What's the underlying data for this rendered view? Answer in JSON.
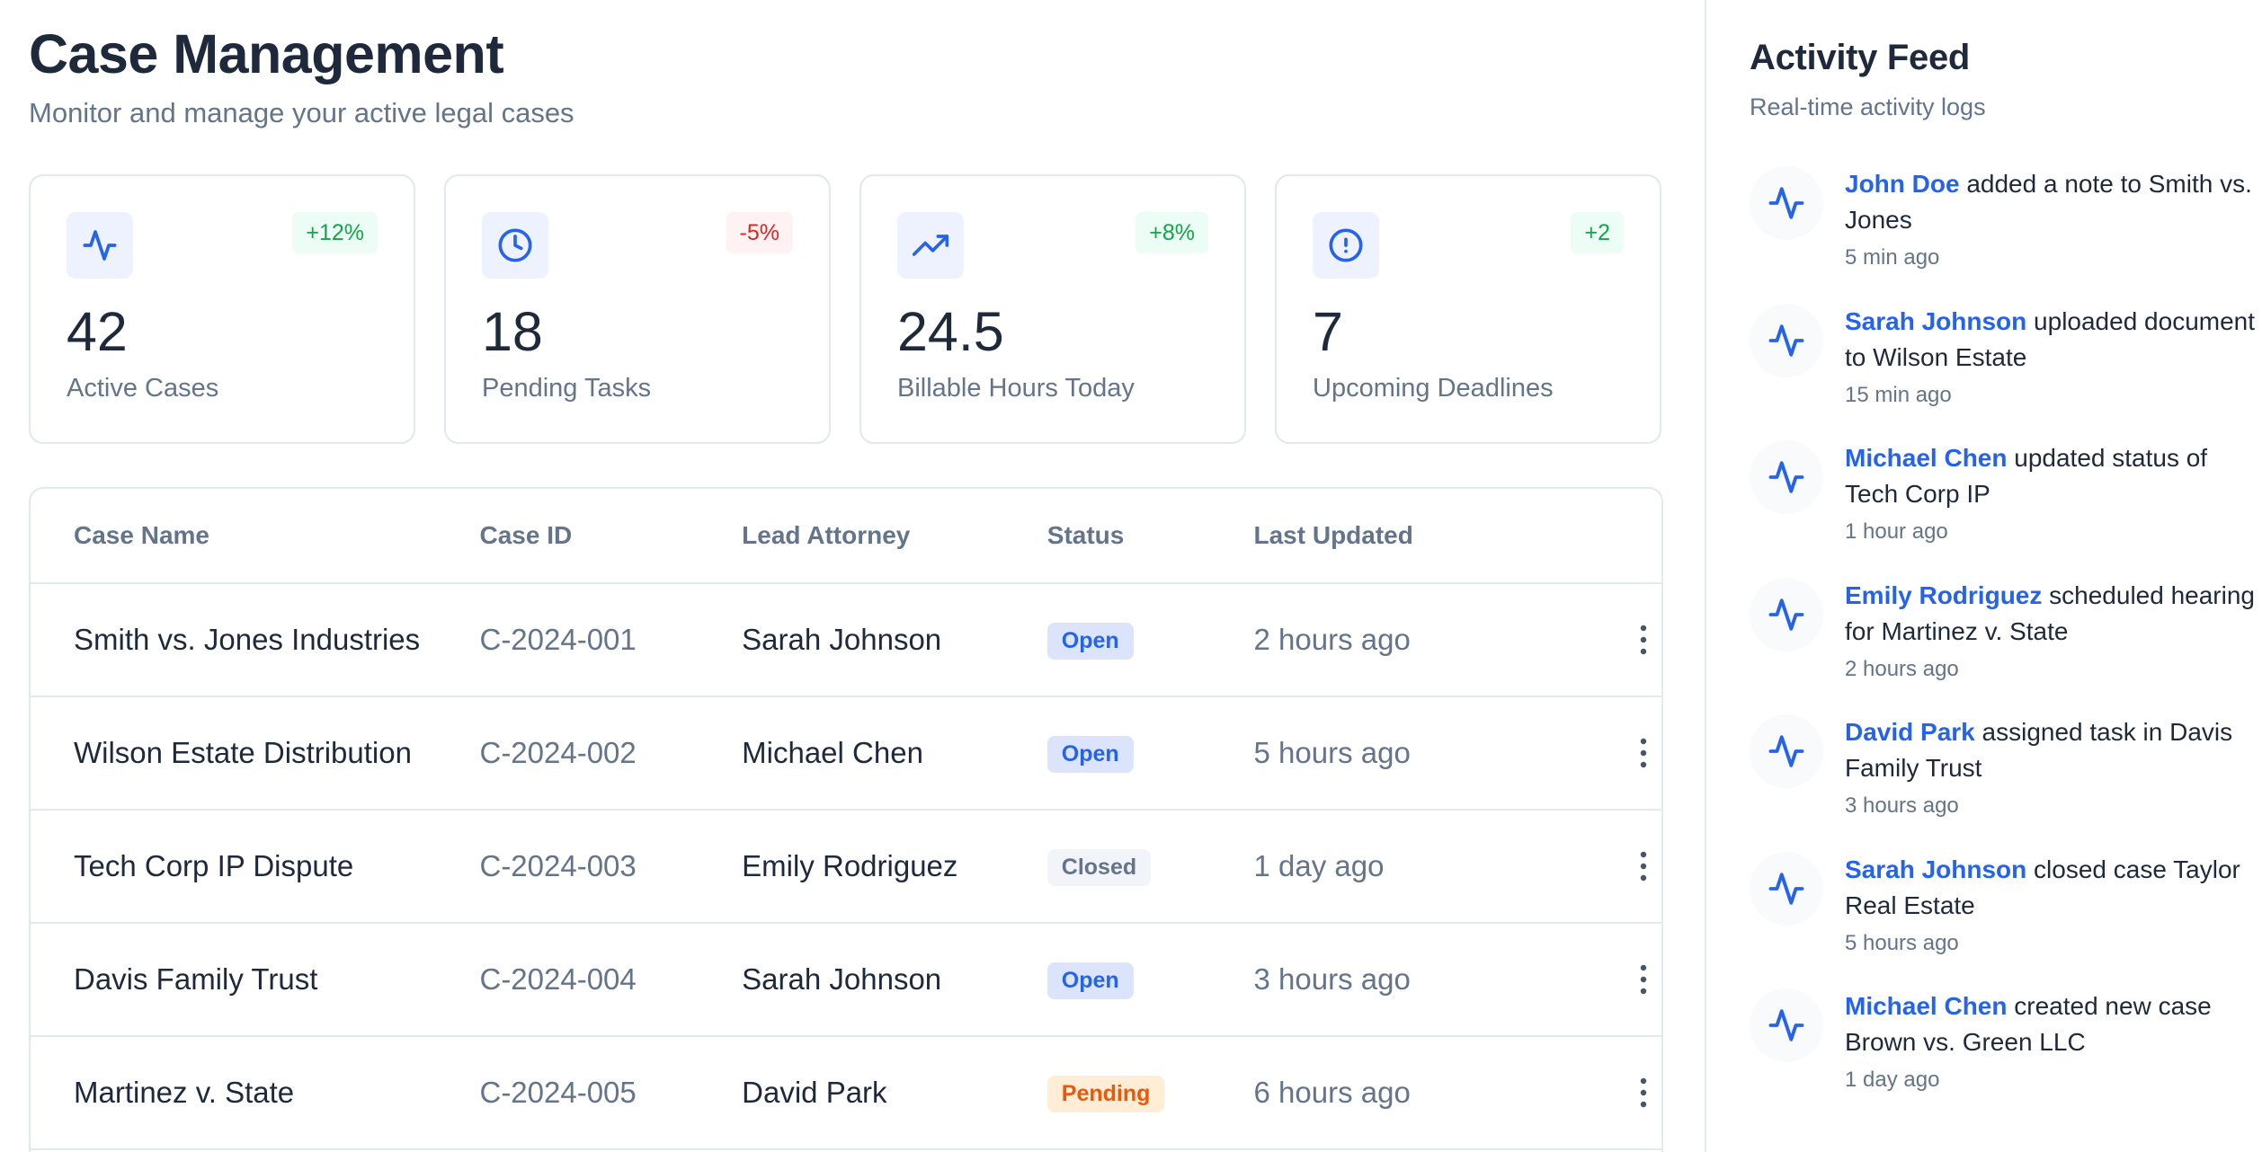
{
  "header": {
    "title": "Case Management",
    "subtitle": "Monitor and manage your active legal cases"
  },
  "stats": [
    {
      "icon": "activity-icon",
      "value": "42",
      "label": "Active Cases",
      "change": "+12%",
      "trend": "up"
    },
    {
      "icon": "clock-icon",
      "value": "18",
      "label": "Pending Tasks",
      "change": "-5%",
      "trend": "down"
    },
    {
      "icon": "trending-up-icon",
      "value": "24.5",
      "label": "Billable Hours Today",
      "change": "+8%",
      "trend": "up"
    },
    {
      "icon": "alert-circle-icon",
      "value": "7",
      "label": "Upcoming Deadlines",
      "change": "+2",
      "trend": "up"
    }
  ],
  "table": {
    "columns": [
      "Case Name",
      "Case ID",
      "Lead Attorney",
      "Status",
      "Last Updated"
    ],
    "rows": [
      {
        "name": "Smith vs. Jones Industries",
        "id": "C-2024-001",
        "attorney": "Sarah Johnson",
        "status": "Open",
        "updated": "2 hours ago"
      },
      {
        "name": "Wilson Estate Distribution",
        "id": "C-2024-002",
        "attorney": "Michael Chen",
        "status": "Open",
        "updated": "5 hours ago"
      },
      {
        "name": "Tech Corp IP Dispute",
        "id": "C-2024-003",
        "attorney": "Emily Rodriguez",
        "status": "Closed",
        "updated": "1 day ago"
      },
      {
        "name": "Davis Family Trust",
        "id": "C-2024-004",
        "attorney": "Sarah Johnson",
        "status": "Open",
        "updated": "3 hours ago"
      },
      {
        "name": "Martinez v. State",
        "id": "C-2024-005",
        "attorney": "David Park",
        "status": "Pending",
        "updated": "6 hours ago"
      }
    ]
  },
  "activity": {
    "title": "Activity Feed",
    "subtitle": "Real-time activity logs",
    "items": [
      {
        "user": "John Doe",
        "action": " added a note to Smith vs. Jones",
        "time": "5 min ago"
      },
      {
        "user": "Sarah Johnson",
        "action": " uploaded document to Wilson Estate",
        "time": "15 min ago"
      },
      {
        "user": "Michael Chen",
        "action": " updated status of Tech Corp IP",
        "time": "1 hour ago"
      },
      {
        "user": "Emily Rodriguez",
        "action": " scheduled hearing for Martinez v. State",
        "time": "2 hours ago"
      },
      {
        "user": "David Park",
        "action": " assigned task in Davis Family Trust",
        "time": "3 hours ago"
      },
      {
        "user": "Sarah Johnson",
        "action": " closed case Taylor Real Estate",
        "time": "5 hours ago"
      },
      {
        "user": "Michael Chen",
        "action": " created new case Brown vs. Green LLC",
        "time": "1 day ago"
      }
    ]
  },
  "colors": {
    "accent": "#2563eb",
    "positive": "#16a34a",
    "negative": "#dc2626",
    "pending": "#ea580c",
    "muted": "#64748b"
  }
}
